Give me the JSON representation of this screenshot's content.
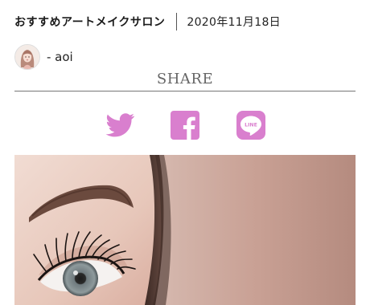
{
  "post_meta": {
    "category": "おすすめアートメイクサロン",
    "date": "2020年11月18日"
  },
  "author": {
    "name": "- aoi"
  },
  "share": {
    "label": "SHARE",
    "buttons": [
      {
        "id": "twitter",
        "icon": "twitter-icon"
      },
      {
        "id": "facebook",
        "icon": "facebook-icon"
      },
      {
        "id": "line",
        "icon": "line-icon",
        "text": "LINE"
      }
    ]
  },
  "hero": {
    "description_icon": "eye-closeup-photo"
  },
  "colors": {
    "accent": "#d97fce",
    "rule": "#777777",
    "text": "#222222"
  }
}
